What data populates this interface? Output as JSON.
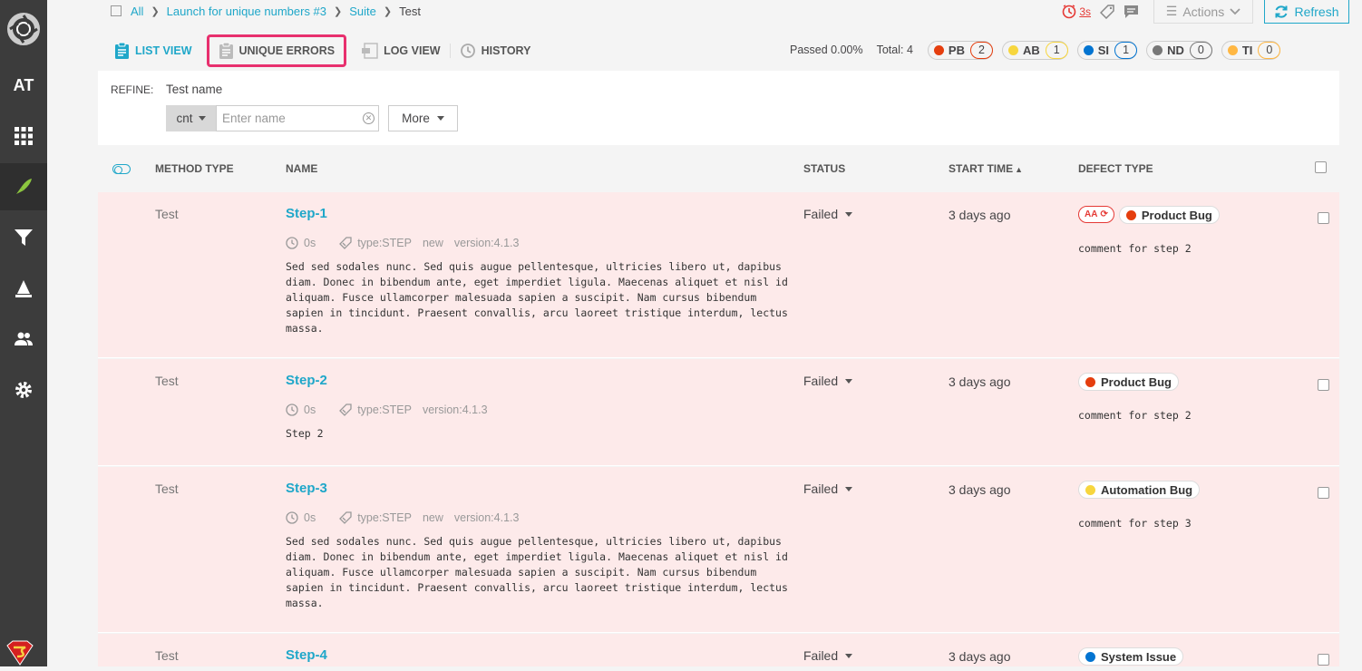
{
  "sidebar": {
    "items": [
      {
        "name": "AT"
      },
      {
        "icon": "dashboard-icon"
      },
      {
        "icon": "launches-icon"
      },
      {
        "icon": "filter-icon"
      },
      {
        "icon": "debug-icon"
      },
      {
        "icon": "members-icon"
      },
      {
        "icon": "settings-icon"
      }
    ],
    "at_label": "AT"
  },
  "breadcrumb": {
    "items": [
      "All",
      "Launch for unique numbers #3",
      "Suite"
    ],
    "current": "Test"
  },
  "header": {
    "duration": "3s",
    "actions_label": "Actions",
    "refresh_label": "Refresh"
  },
  "views": {
    "list": "LIST VIEW",
    "unique": "UNIQUE ERRORS",
    "log": "LOG VIEW",
    "history": "HISTORY"
  },
  "stats": {
    "passed": "Passed 0.00%",
    "total": "Total: 4",
    "defects": [
      {
        "label": "PB",
        "count": "2",
        "color": "#e53e0e"
      },
      {
        "label": "AB",
        "count": "1",
        "color": "#f7d63e"
      },
      {
        "label": "SI",
        "count": "1",
        "color": "#0274d1"
      },
      {
        "label": "ND",
        "count": "0",
        "color": "#777777"
      },
      {
        "label": "TI",
        "count": "0",
        "color": "#ffb743"
      }
    ]
  },
  "refine": {
    "label": "REFINE:",
    "field_label": "Test name",
    "condition": "cnt",
    "placeholder": "Enter name",
    "more_label": "More"
  },
  "table": {
    "headers": {
      "method": "METHOD TYPE",
      "name": "NAME",
      "status": "STATUS",
      "start": "START TIME",
      "defect": "DEFECT TYPE"
    },
    "rows": [
      {
        "method": "Test",
        "name": "Step-1",
        "duration": "0s",
        "attr": "type:STEP",
        "tag": "new",
        "version": "version:4.1.3",
        "desc": "Sed sed sodales nunc. Sed quis augue pellentesque, ultricies libero ut, dapibus diam. Donec in bibendum ante, eget imperdiet ligula. Maecenas aliquet et nisl id aliquam. Fusce ullamcorper malesuada sapien a suscipit. Nam cursus bibendum sapien in tincidunt. Praesent convallis, arcu laoreet tristique interdum, lectus massa.",
        "status": "Failed",
        "time": "3 days ago",
        "aa": "AA",
        "defect": "Product Bug",
        "defect_color": "#e53e0e",
        "comment": "comment for step 2"
      },
      {
        "method": "Test",
        "name": "Step-2",
        "duration": "0s",
        "attr": "type:STEP",
        "tag": "",
        "version": "version:4.1.3",
        "desc": "Step 2",
        "status": "Failed",
        "time": "3 days ago",
        "defect": "Product Bug",
        "defect_color": "#e53e0e",
        "comment": "comment for step 2"
      },
      {
        "method": "Test",
        "name": "Step-3",
        "duration": "0s",
        "attr": "type:STEP",
        "tag": "new",
        "version": "version:4.1.3",
        "desc": "Sed sed sodales nunc. Sed quis augue pellentesque, ultricies libero ut, dapibus diam. Donec in bibendum ante, eget imperdiet ligula. Maecenas aliquet et nisl id aliquam. Fusce ullamcorper malesuada sapien a suscipit. Nam cursus bibendum sapien in tincidunt. Praesent convallis, arcu laoreet tristique interdum, lectus massa.",
        "status": "Failed",
        "time": "3 days ago",
        "defect": "Automation Bug",
        "defect_color": "#f7d63e",
        "comment": "comment for step 3"
      },
      {
        "method": "Test",
        "name": "Step-4",
        "status": "Failed",
        "time": "3 days ago",
        "defect": "System Issue",
        "defect_color": "#0274d1"
      }
    ]
  }
}
